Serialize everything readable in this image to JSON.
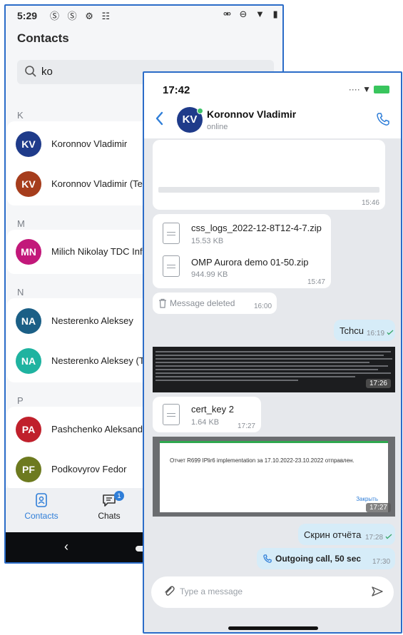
{
  "contacts_screen": {
    "status": {
      "time": "5:29",
      "left_icons": "Ⓢ Ⓢ ⚙ ☷",
      "right_icons": "⚮ ⊖ ▼ ▮"
    },
    "title": "Contacts",
    "search": {
      "value": "ko"
    },
    "sections": [
      {
        "letter": "K",
        "contacts": [
          {
            "initials": "KV",
            "name": "Koronnov Vladimir",
            "color": "#1f3b8a"
          },
          {
            "initials": "KV",
            "name": "Koronnov Vladimir (Tes",
            "color": "#a63d1c"
          }
        ]
      },
      {
        "letter": "M",
        "contacts": [
          {
            "initials": "MN",
            "name": "Milich Nikolay TDC Info",
            "color": "#c2187a"
          }
        ]
      },
      {
        "letter": "N",
        "contacts": [
          {
            "initials": "NA",
            "name": "Nesterenko Aleksey",
            "color": "#1b5f86"
          },
          {
            "initials": "NA",
            "name": "Nesterenko Aleksey (Te",
            "color": "#1fb3a0"
          }
        ]
      },
      {
        "letter": "P",
        "contacts": [
          {
            "initials": "PA",
            "name": "Pashchenko Aleksandr",
            "color": "#c0202c"
          },
          {
            "initials": "PF",
            "name": "Podkovyrov Fedor",
            "color": "#6d7a1f"
          }
        ]
      }
    ],
    "tabs": [
      {
        "label": "Contacts",
        "active": true
      },
      {
        "label": "Chats",
        "badge": "1"
      }
    ],
    "navbar": {
      "back_glyph": "‹"
    }
  },
  "chat_screen": {
    "status": {
      "time": "17:42",
      "icons": "···· ▼"
    },
    "contact": {
      "initials": "KV",
      "name": "Koronnov Vladimir",
      "presence": "online"
    },
    "messages": {
      "m1_time": "15:46",
      "files1": [
        {
          "name": "css_logs_2022-12-8T12-4-7.zip",
          "size": "15.53 KB"
        },
        {
          "name": "OMP Aurora demo 01-50.zip",
          "size": "944.99 KB"
        }
      ],
      "files1_time": "15:47",
      "deleted": {
        "text": "Message deleted",
        "time": "16:00"
      },
      "tchcu": {
        "text": "Tchcu",
        "time": "16:19"
      },
      "log_image_time": "17:26",
      "cert": {
        "name": "cert_key 2",
        "size": "1.64 KB",
        "time": "17:27"
      },
      "dialog_image": {
        "text": "Отчет R699 IPlir6 implementation за 17.10.2022-23.10.2022 отправлен.",
        "button": "Закрыть",
        "time": "17:27"
      },
      "screen_report": {
        "text": "Скрин отчёта",
        "time": "17:28"
      },
      "call": {
        "text": "Outgoing call, 50 sec",
        "time": "17:30"
      }
    },
    "composer": {
      "placeholder": "Type a message"
    }
  }
}
